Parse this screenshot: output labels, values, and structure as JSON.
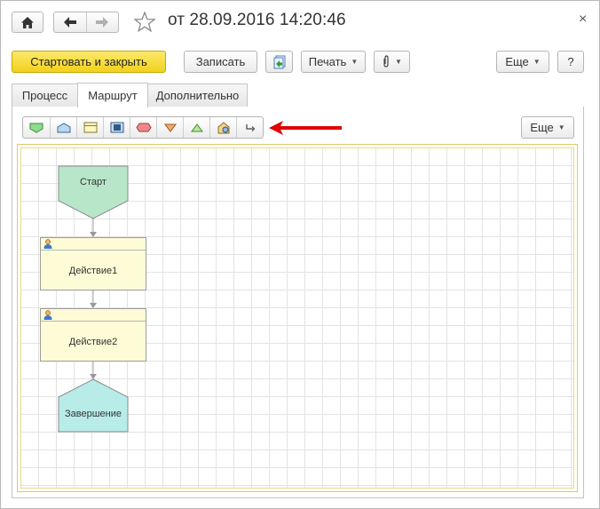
{
  "window": {
    "title": "от 28.09.2016 14:20:46"
  },
  "commands": {
    "start_and_close": "Стартовать и закрыть",
    "save": "Записать",
    "print": "Печать",
    "more": "Еще",
    "help": "?"
  },
  "tabs": [
    {
      "label": "Процесс",
      "active": false
    },
    {
      "label": "Маршрут",
      "active": true
    },
    {
      "label": "Дополнительно",
      "active": false
    }
  ],
  "route_toolbar": {
    "tools": [
      "start-point-icon",
      "end-point-icon",
      "action-icon",
      "subprocess-icon",
      "condition-icon",
      "split-icon",
      "merge-icon",
      "process-point-icon",
      "connector-icon"
    ],
    "more": "Еще"
  },
  "diagram": {
    "start": "Старт",
    "actions": [
      "Действие1",
      "Действие2"
    ],
    "end": "Завершение"
  },
  "colors": {
    "primary_button": "#f2d21c",
    "start_node": "#b8e6c8",
    "action_node": "#fefcd6",
    "end_node": "#b8ece8",
    "annotation_arrow": "#e00000"
  }
}
